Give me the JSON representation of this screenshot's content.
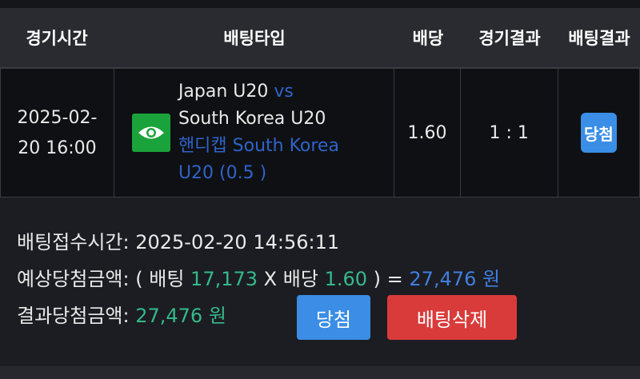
{
  "table": {
    "headers": {
      "time": "경기시간",
      "type": "배팅타입",
      "odds": "배당",
      "result": "경기결과",
      "bet_result": "배팅결과"
    },
    "row": {
      "time_line1": "2025-02-",
      "time_line2": "20 16:00",
      "team_home": "Japan U20",
      "vs": "vs",
      "team_away": "South Korea U20",
      "handicap_line1": "핸디캡 South Korea",
      "handicap_line2": "U20 (0.5 )",
      "odds": "1.60",
      "score": "1 : 1",
      "bet_result": "당첨"
    }
  },
  "details": {
    "bet_time_label": "배팅접수시간:",
    "bet_time_value": "2025-02-20 14:56:11",
    "expected_label": "예상당첨금액:",
    "open_paren": "(",
    "bet_word": "배팅",
    "bet_amount": "17,173",
    "times": "X",
    "odds_word": "배당",
    "odds_value": "1.60",
    "close_eq": ") =",
    "expected_value": "27,476 원",
    "result_label": "결과당첨금액:",
    "result_value": "27,476 원"
  },
  "buttons": {
    "win": "당첨",
    "delete": "배팅삭제"
  },
  "colors": {
    "win_blue": "#3b8de5",
    "delete_red": "#d93b3b",
    "amount_green": "#35b98a",
    "link_blue": "#2f63c9"
  }
}
